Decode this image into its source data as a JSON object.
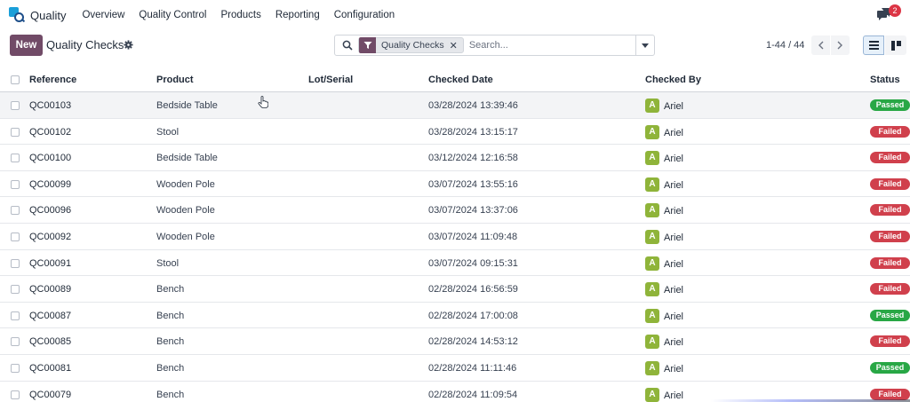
{
  "app": {
    "name": "Quality",
    "menu": [
      "Overview",
      "Quality Control",
      "Products",
      "Reporting",
      "Configuration"
    ],
    "messages_badge": "2"
  },
  "control_panel": {
    "new_label": "New",
    "title": "Quality Checks",
    "facet_label": "Quality Checks",
    "facet_remove": "✕",
    "search_placeholder": "Search...",
    "pager": "1-44 / 44"
  },
  "table": {
    "columns": [
      "Reference",
      "Product",
      "Lot/Serial",
      "Checked Date",
      "Checked By",
      "Status"
    ],
    "rows": [
      {
        "ref": "QC00103",
        "product": "Bedside Table",
        "lot": "",
        "date": "03/28/2024 13:39:46",
        "avatar": "A",
        "user": "Ariel",
        "status": "Passed"
      },
      {
        "ref": "QC00102",
        "product": "Stool",
        "lot": "",
        "date": "03/28/2024 13:15:17",
        "avatar": "A",
        "user": "Ariel",
        "status": "Failed"
      },
      {
        "ref": "QC00100",
        "product": "Bedside Table",
        "lot": "",
        "date": "03/12/2024 12:16:58",
        "avatar": "A",
        "user": "Ariel",
        "status": "Failed"
      },
      {
        "ref": "QC00099",
        "product": "Wooden Pole",
        "lot": "",
        "date": "03/07/2024 13:55:16",
        "avatar": "A",
        "user": "Ariel",
        "status": "Failed"
      },
      {
        "ref": "QC00096",
        "product": "Wooden Pole",
        "lot": "",
        "date": "03/07/2024 13:37:06",
        "avatar": "A",
        "user": "Ariel",
        "status": "Failed"
      },
      {
        "ref": "QC00092",
        "product": "Wooden Pole",
        "lot": "",
        "date": "03/07/2024 11:09:48",
        "avatar": "A",
        "user": "Ariel",
        "status": "Failed"
      },
      {
        "ref": "QC00091",
        "product": "Stool",
        "lot": "",
        "date": "03/07/2024 09:15:31",
        "avatar": "A",
        "user": "Ariel",
        "status": "Failed"
      },
      {
        "ref": "QC00089",
        "product": "Bench",
        "lot": "",
        "date": "02/28/2024 16:56:59",
        "avatar": "A",
        "user": "Ariel",
        "status": "Failed"
      },
      {
        "ref": "QC00087",
        "product": "Bench",
        "lot": "",
        "date": "02/28/2024 17:00:08",
        "avatar": "A",
        "user": "Ariel",
        "status": "Passed"
      },
      {
        "ref": "QC00085",
        "product": "Bench",
        "lot": "",
        "date": "02/28/2024 14:53:12",
        "avatar": "A",
        "user": "Ariel",
        "status": "Failed"
      },
      {
        "ref": "QC00081",
        "product": "Bench",
        "lot": "",
        "date": "02/28/2024 11:11:46",
        "avatar": "A",
        "user": "Ariel",
        "status": "Passed"
      },
      {
        "ref": "QC00079",
        "product": "Bench",
        "lot": "",
        "date": "02/28/2024 11:09:54",
        "avatar": "A",
        "user": "Ariel",
        "status": "Failed"
      }
    ]
  },
  "colors": {
    "brand": "#714b67",
    "passed": "#28a745",
    "failed": "#d0404c",
    "avatar": "#8fb43a"
  },
  "icons": {
    "app_logo": "quality-logo-icon",
    "settings": "gear-icon",
    "search": "search-icon",
    "filter": "filter-icon",
    "chat": "chat-icon",
    "list_view": "list-view-icon",
    "kanban_view": "kanban-view-icon"
  }
}
